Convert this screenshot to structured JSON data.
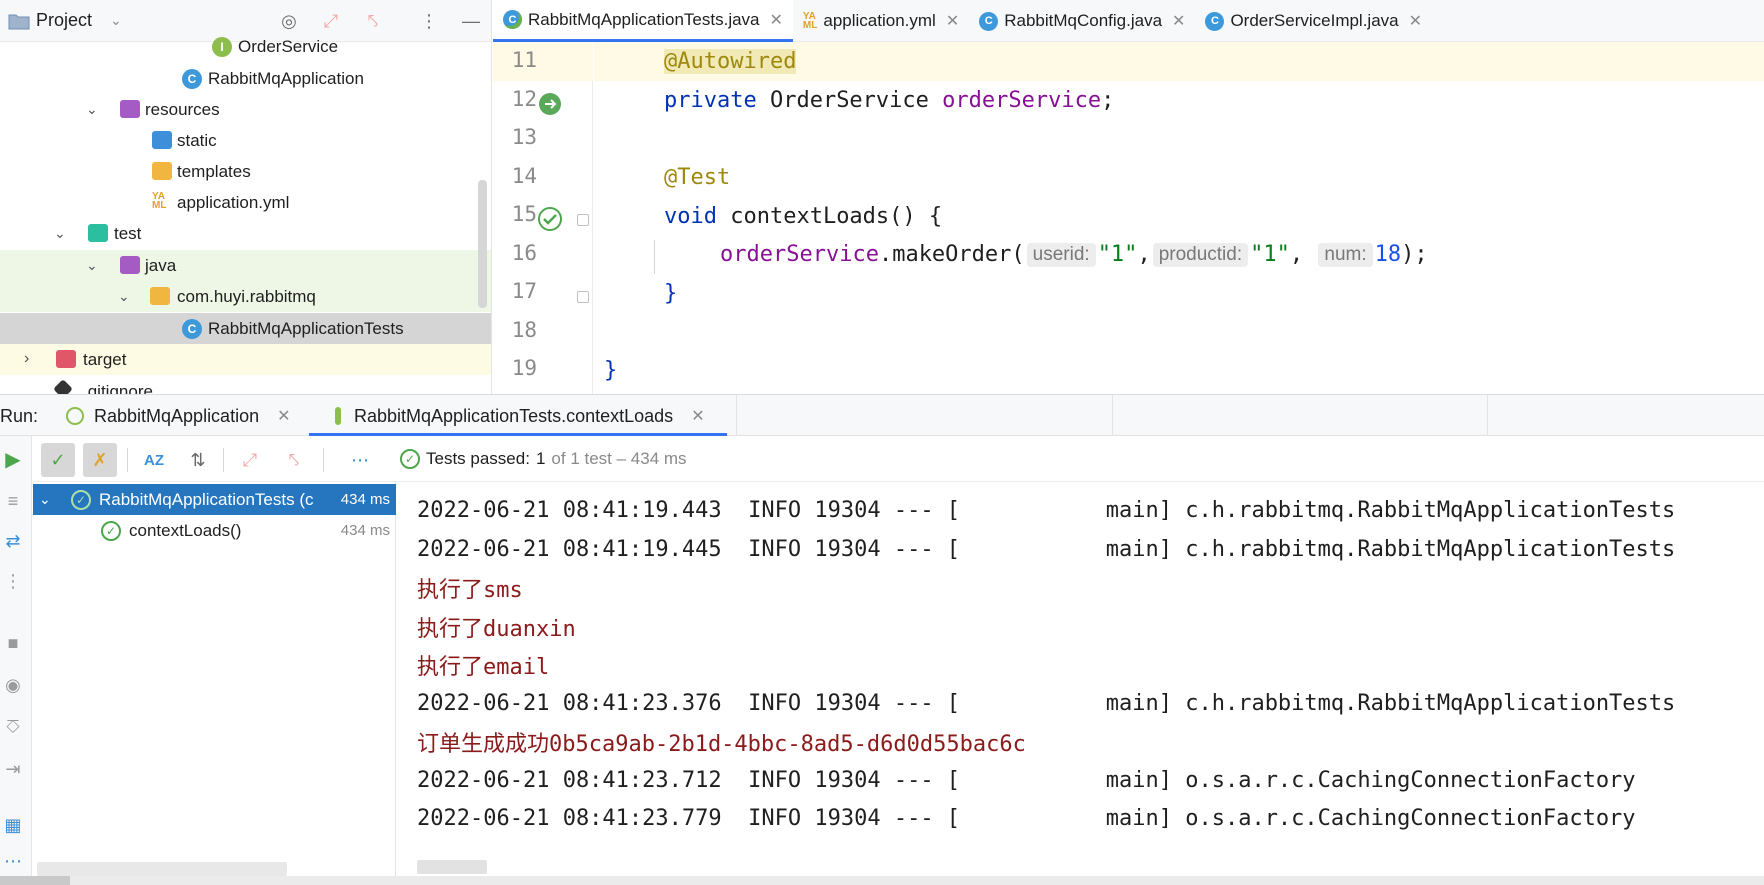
{
  "project": {
    "title": "Project",
    "tree": [
      {
        "label": "OrderService",
        "kind": "interface"
      },
      {
        "label": "RabbitMqApplication",
        "kind": "class"
      },
      {
        "label": "resources",
        "kind": "folder"
      },
      {
        "label": "static",
        "kind": "folder"
      },
      {
        "label": "templates",
        "kind": "folder"
      },
      {
        "label": "application.yml",
        "kind": "yml"
      },
      {
        "label": "test",
        "kind": "folder"
      },
      {
        "label": "java",
        "kind": "folder"
      },
      {
        "label": "com.huyi.rabbitmq",
        "kind": "package"
      },
      {
        "label": "RabbitMqApplicationTests",
        "kind": "class"
      },
      {
        "label": "target",
        "kind": "folder"
      },
      {
        "label": ".gitignore",
        "kind": "file"
      }
    ]
  },
  "editor": {
    "tabs": [
      {
        "label": "RabbitMqApplicationTests.java",
        "active": true
      },
      {
        "label": "application.yml",
        "active": false
      },
      {
        "label": "RabbitMqConfig.java",
        "active": false
      },
      {
        "label": "OrderServiceImpl.java",
        "active": false
      }
    ],
    "line_numbers": [
      "11",
      "12",
      "13",
      "14",
      "15",
      "16",
      "17",
      "18",
      "19"
    ],
    "code": {
      "l11_annotation": "@Autowired",
      "l12_kw": "private",
      "l12_type": " OrderService ",
      "l12_field": "orderService",
      "l12_end": ";",
      "l14_annotation": "@Test",
      "l15_kw": "void",
      "l15_rest": " contextLoads() {",
      "l16_field": "orderService",
      "l16_call": ".makeOrder(",
      "l16_hint1": "userid:",
      "l16_arg1": "\"1\"",
      "l16_comma1": ",",
      "l16_hint2": "productid:",
      "l16_arg2": "\"1\"",
      "l16_comma2": ", ",
      "l16_hint3": "num:",
      "l16_arg3": "18",
      "l16_end": ");",
      "l17": "}",
      "l19": "}"
    }
  },
  "run": {
    "label": "Run:",
    "tabs": [
      {
        "label": "RabbitMqApplication"
      },
      {
        "label": "RabbitMqApplicationTests.contextLoads"
      }
    ],
    "status": {
      "passed_label": "Tests passed:",
      "passed_count": "1",
      "detail": "of 1 test – 434 ms"
    },
    "test_tree": [
      {
        "label": "RabbitMqApplicationTests (c",
        "time": "434 ms"
      },
      {
        "label": "contextLoads()",
        "time": "434 ms"
      }
    ],
    "console": [
      {
        "text": "2022-06-21 08:41:19.443  INFO 19304 --- [           main] c.h.rabbitmq.RabbitMqApplicationTests",
        "type": "log"
      },
      {
        "text": "2022-06-21 08:41:19.445  INFO 19304 --- [           main] c.h.rabbitmq.RabbitMqApplicationTests",
        "type": "log"
      },
      {
        "text": "执行了sms",
        "type": "out"
      },
      {
        "text": "执行了duanxin",
        "type": "out"
      },
      {
        "text": "执行了email",
        "type": "out"
      },
      {
        "text": "2022-06-21 08:41:23.376  INFO 19304 --- [           main] c.h.rabbitmq.RabbitMqApplicationTests",
        "type": "log"
      },
      {
        "text": "订单生成成功0b5ca9ab-2b1d-4bbc-8ad5-d6d0d55bac6c",
        "type": "out"
      },
      {
        "text": "2022-06-21 08:41:23.712  INFO 19304 --- [           main] o.s.a.r.c.CachingConnectionFactory",
        "type": "log"
      },
      {
        "text": "2022-06-21 08:41:23.779  INFO 19304 --- [           main] o.s.a.r.c.CachingConnectionFactory",
        "type": "log"
      }
    ]
  },
  "colors": {
    "accent": "#3574f0",
    "selection": "#2675bf",
    "pass_green": "#4ca64c",
    "console_output": "#8b1a1a"
  }
}
